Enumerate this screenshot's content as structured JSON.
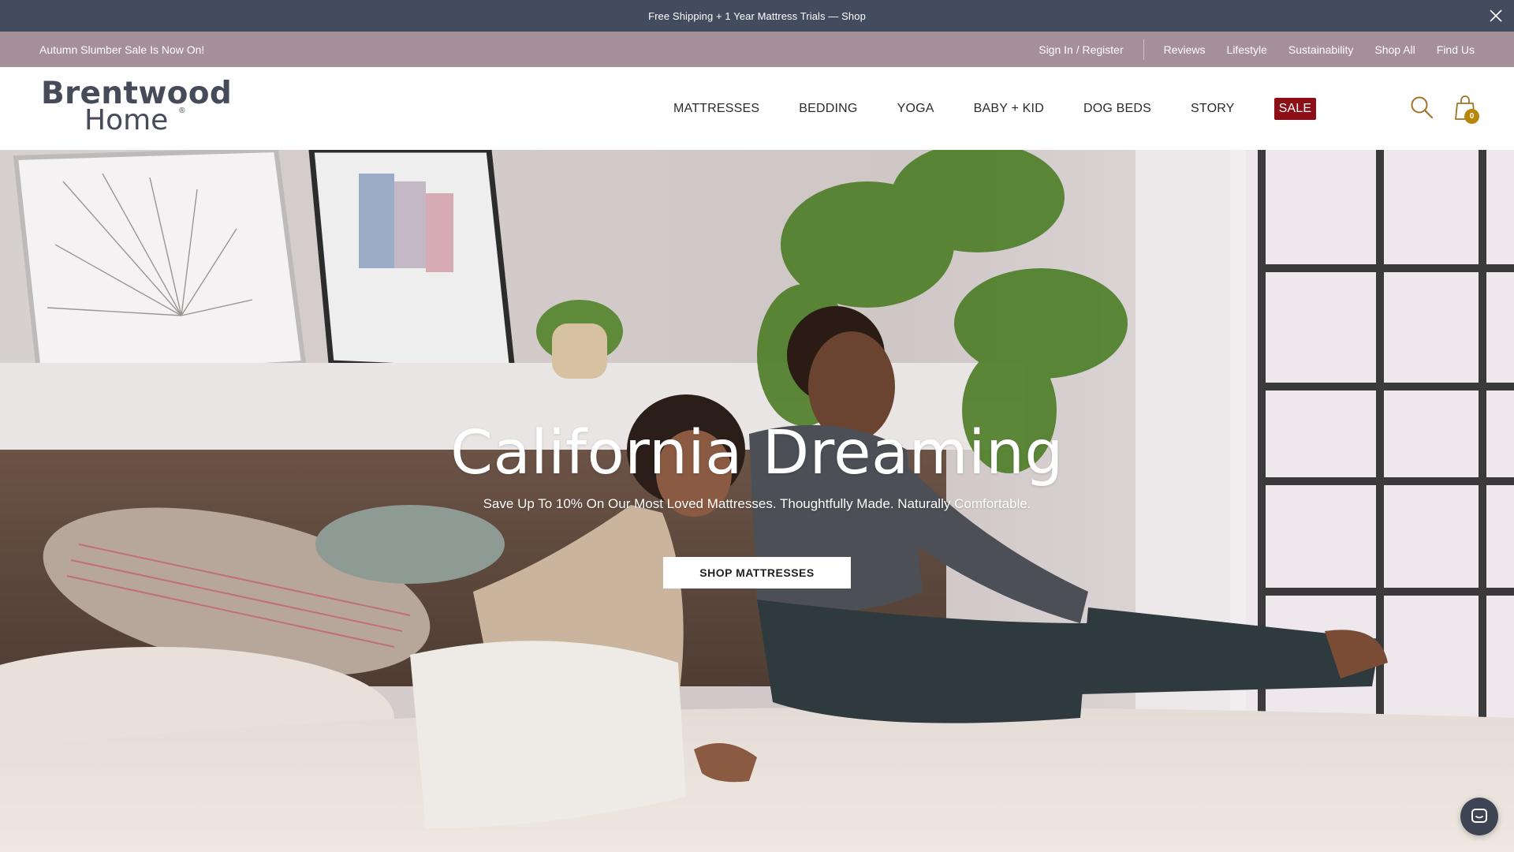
{
  "announcement": {
    "text": "Free Shipping + 1 Year Mattress Trials — Shop"
  },
  "utility_bar": {
    "promo": "Autumn Slumber Sale Is Now On!",
    "sign_in": "Sign In / Register",
    "links": [
      "Reviews",
      "Lifestyle",
      "Sustainability",
      "Shop All",
      "Find Us"
    ]
  },
  "header": {
    "logo_line1": "Brentwood",
    "logo_line2": "Home",
    "logo_mark": "®",
    "nav": [
      "MATTRESSES",
      "BEDDING",
      "YOGA",
      "BABY + KID",
      "DOG BEDS",
      "STORY"
    ],
    "sale_label": "SALE",
    "cart_count": "0"
  },
  "hero": {
    "title": "California Dreaming",
    "subtitle": "Save Up To 10% On Our Most Loved Mattresses. Thoughtfully Made. Naturally Comfortable.",
    "cta": "SHOP MATTRESSES"
  },
  "icons": {
    "close": "close-icon",
    "search": "search-icon",
    "cart": "shopping-bag-icon",
    "chat": "chat-icon"
  },
  "colors": {
    "announcement_bg": "#434b5e",
    "utility_bg": "#a58f99",
    "sale_bg": "#8c0f17",
    "logo": "#454b59",
    "cart_badge": "#b8860b"
  }
}
